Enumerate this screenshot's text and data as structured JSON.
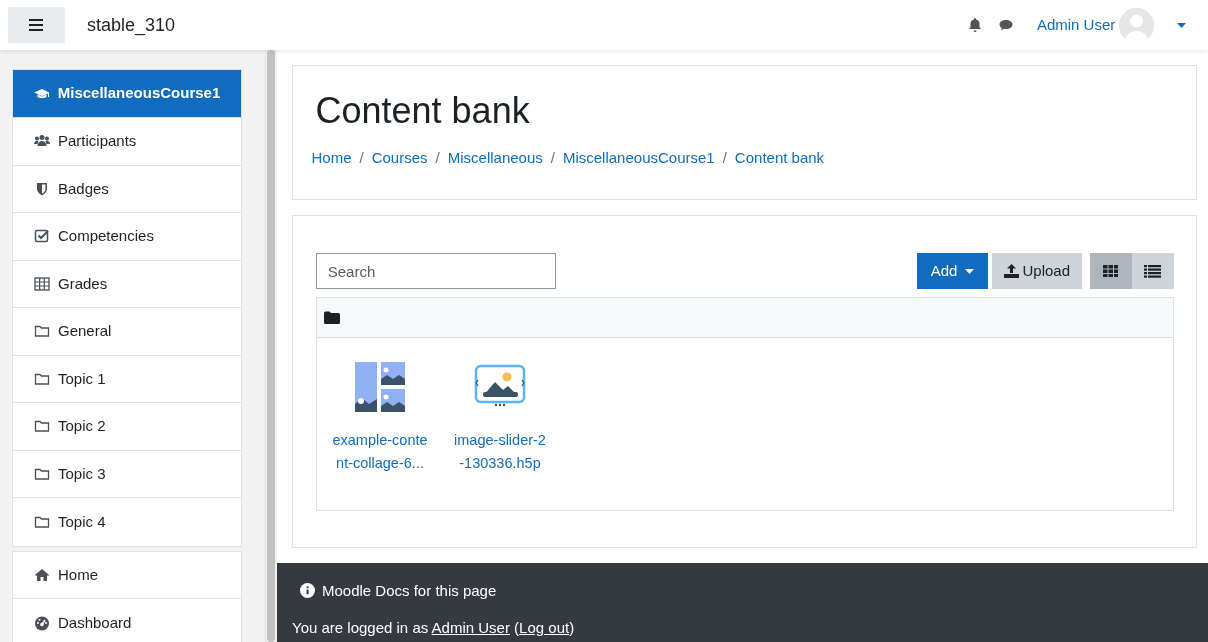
{
  "navbar": {
    "site_name": "stable_310",
    "user_name": "Admin User"
  },
  "sidebar": {
    "groups": [
      {
        "items": [
          {
            "label": "MiscellaneousCourse1",
            "kind": "course",
            "selected": true
          },
          {
            "label": "Participants",
            "kind": "participants",
            "selected": false
          },
          {
            "label": "Badges",
            "kind": "badges",
            "selected": false
          },
          {
            "label": "Competencies",
            "kind": "competencies",
            "selected": false
          },
          {
            "label": "Grades",
            "kind": "grades",
            "selected": false
          },
          {
            "label": "General",
            "kind": "section",
            "selected": false
          },
          {
            "label": "Topic 1",
            "kind": "section",
            "selected": false
          },
          {
            "label": "Topic 2",
            "kind": "section",
            "selected": false
          },
          {
            "label": "Topic 3",
            "kind": "section",
            "selected": false
          },
          {
            "label": "Topic 4",
            "kind": "section",
            "selected": false
          }
        ]
      },
      {
        "items": [
          {
            "label": "Home",
            "kind": "home",
            "selected": false
          },
          {
            "label": "Dashboard",
            "kind": "dashboard",
            "selected": false
          }
        ]
      }
    ]
  },
  "header": {
    "title": "Content bank",
    "breadcrumb_separator": "/",
    "breadcrumb": [
      "Home",
      "Courses",
      "Miscellaneous",
      "MiscellaneousCourse1",
      "Content bank"
    ]
  },
  "toolbar": {
    "search": {
      "placeholder": "Search"
    },
    "add_button": "Add",
    "upload_button": "Upload",
    "view_buttons": [
      {
        "kind": "grid",
        "selected": true
      },
      {
        "kind": "list",
        "selected": false
      }
    ]
  },
  "files": [
    {
      "name": "example-conte nt-collage-6...",
      "kind": "collage"
    },
    {
      "name": "image-slider-2 -130336.h5p",
      "kind": "slider"
    }
  ],
  "footer": {
    "docs_link": "Moodle Docs for this page",
    "login_prefix": "You are logged in as",
    "user_link": "Admin User",
    "paren_open": "(",
    "logout_link": "Log out",
    "paren_close": ")"
  }
}
